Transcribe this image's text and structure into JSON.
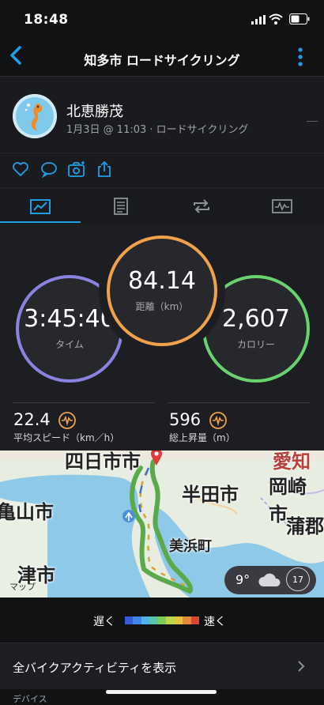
{
  "status": {
    "time": "18:48"
  },
  "header": {
    "title": "知多市 ロードサイクリング"
  },
  "profile": {
    "name": "北恵勝茂",
    "subline": "1月3日 @ 11:03 · ロードサイクリング"
  },
  "stats": {
    "time": {
      "value": "3:45:40",
      "label": "タイム"
    },
    "distance": {
      "value": "84.14",
      "label": "距離（km）"
    },
    "calories": {
      "value": "2,607",
      "label": "カロリー"
    },
    "avg_speed": {
      "value": "22.4",
      "label": "平均スピード（km／h）"
    },
    "ascent": {
      "value": "596",
      "label": "総上昇量（m）"
    }
  },
  "map": {
    "labels": {
      "yokkaichi": "四日市市",
      "aichi": "愛知",
      "handa": "半田市",
      "okazaki": "岡崎市",
      "kameyama": "亀山市",
      "gamagori": "蒲郡",
      "mihama": "美浜町",
      "tsu": "津市",
      "maps": "マップ"
    },
    "weather": {
      "temp": "9°",
      "wind": "17"
    }
  },
  "legend": {
    "slow": "遅く",
    "fast": "速く",
    "colors": [
      "#3a5bd8",
      "#3f86e6",
      "#4fb3e6",
      "#58c6a6",
      "#7ccc57",
      "#b9d84a",
      "#e6c23f",
      "#e68a3a",
      "#d9472f"
    ]
  },
  "list": {
    "all_bike": "全バイクアクティビティを表示",
    "devices": "デバイス"
  },
  "colors": {
    "accent": "#1fa0e6",
    "ring_time": "#8a83e0",
    "ring_distance": "#f0a24a",
    "ring_calories": "#68d26e",
    "chart_icon": "#f0a24a"
  }
}
